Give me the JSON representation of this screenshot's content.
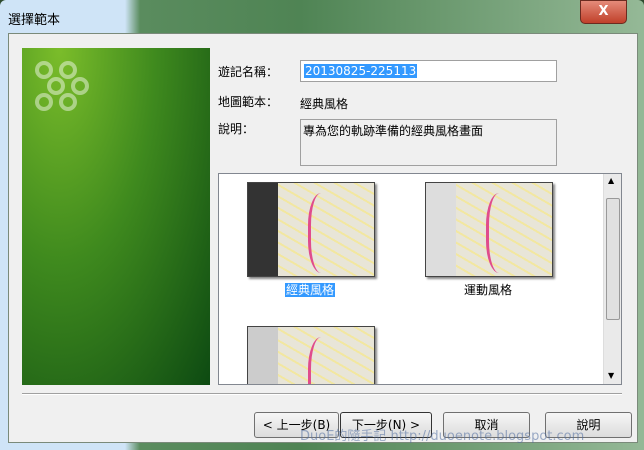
{
  "window": {
    "title": "選擇範本",
    "close_label": "X"
  },
  "form": {
    "name_label": "遊記名稱：",
    "name_value": "20130825-225113",
    "template_label": "地圖範本：",
    "template_value": "經典風格",
    "desc_label": "說明：",
    "desc_value": "專為您的軌跡準備的經典風格畫面"
  },
  "templates": [
    {
      "label": "經典風格",
      "selected": true
    },
    {
      "label": "運動風格",
      "selected": false
    },
    {
      "label": "",
      "selected": false
    }
  ],
  "buttons": {
    "back": "< 上一步(B)",
    "next": "下一步(N) >",
    "cancel": "取消",
    "help": "說明"
  },
  "watermark": "DuoE的隨手記 http://duoenote.blogspot.com"
}
